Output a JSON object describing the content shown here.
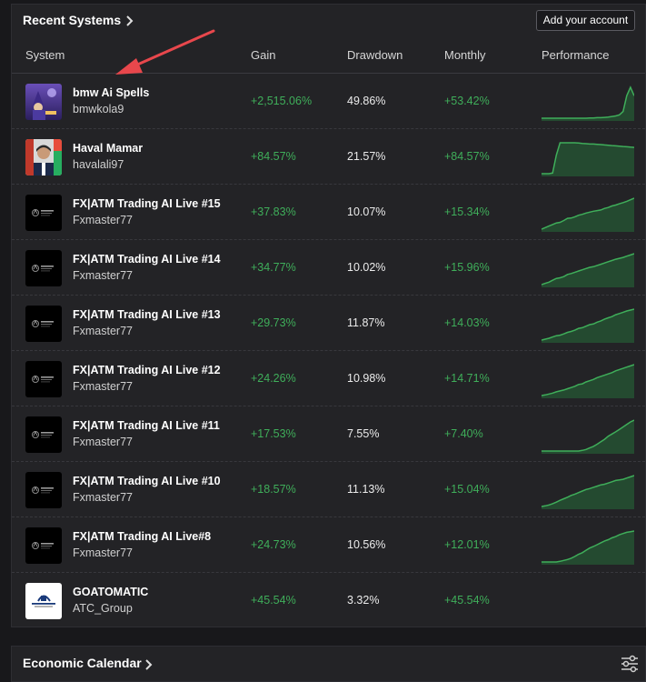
{
  "recent": {
    "title": "Recent Systems",
    "add_button": "Add your account",
    "columns": {
      "system": "System",
      "gain": "Gain",
      "drawdown": "Drawdown",
      "monthly": "Monthly",
      "performance": "Performance"
    },
    "rows": [
      {
        "name": "bmw Ai Spells",
        "user": "bmwkola9",
        "gain": "+2,515.06%",
        "drawdown": "49.86%",
        "monthly": "+53.42%",
        "avatar": "wizard-avatar",
        "perf": [
          0,
          0,
          0,
          0,
          0,
          0,
          0,
          0,
          0,
          0,
          0,
          0,
          0,
          0.5,
          0.5,
          1,
          1,
          1.5,
          2,
          3,
          4,
          6,
          12,
          40,
          55,
          40
        ]
      },
      {
        "name": "Haval Mamar",
        "user": "havalali97",
        "gain": "+84.57%",
        "drawdown": "21.57%",
        "monthly": "+84.57%",
        "avatar": "person-avatar",
        "perf": [
          0,
          0,
          0,
          2,
          60,
          100,
          100,
          100,
          100,
          100,
          99,
          98,
          97,
          96,
          96,
          95,
          94,
          93,
          92,
          91,
          90,
          89,
          88,
          87,
          86,
          85
        ]
      },
      {
        "name": "FX|ATM Trading AI Live #15",
        "user": "Fxmaster77",
        "gain": "+37.83%",
        "drawdown": "10.07%",
        "monthly": "+15.34%",
        "avatar": "fxatm-logo",
        "perf": [
          0,
          5,
          10,
          15,
          20,
          22,
          28,
          35,
          36,
          40,
          45,
          48,
          52,
          55,
          58,
          60,
          62,
          67,
          70,
          75,
          78,
          82,
          86,
          90,
          95,
          100
        ]
      },
      {
        "name": "FX|ATM Trading AI Live #14",
        "user": "Fxmaster77",
        "gain": "+34.77%",
        "drawdown": "10.02%",
        "monthly": "+15.96%",
        "avatar": "fxatm-logo",
        "perf": [
          0,
          4,
          8,
          14,
          20,
          22,
          26,
          33,
          36,
          40,
          44,
          48,
          52,
          56,
          58,
          62,
          66,
          70,
          74,
          78,
          82,
          85,
          88,
          92,
          96,
          100
        ]
      },
      {
        "name": "FX|ATM Trading AI Live #13",
        "user": "Fxmaster77",
        "gain": "+29.73%",
        "drawdown": "11.87%",
        "monthly": "+14.03%",
        "avatar": "fxatm-logo",
        "perf": [
          0,
          3,
          6,
          10,
          14,
          16,
          20,
          25,
          28,
          32,
          38,
          40,
          45,
          50,
          52,
          58,
          62,
          68,
          72,
          76,
          82,
          86,
          90,
          94,
          97,
          100
        ]
      },
      {
        "name": "FX|ATM Trading AI Live #12",
        "user": "Fxmaster77",
        "gain": "+24.26%",
        "drawdown": "10.98%",
        "monthly": "+14.71%",
        "avatar": "fxatm-logo",
        "perf": [
          0,
          2,
          5,
          8,
          12,
          15,
          18,
          22,
          26,
          30,
          36,
          38,
          44,
          48,
          52,
          58,
          62,
          66,
          70,
          74,
          80,
          84,
          88,
          92,
          96,
          100
        ]
      },
      {
        "name": "FX|ATM Trading AI Live #11",
        "user": "Fxmaster77",
        "gain": "+17.53%",
        "drawdown": "7.55%",
        "monthly": "+7.40%",
        "avatar": "fxatm-logo",
        "perf": [
          0,
          0,
          0,
          0,
          0,
          0,
          0,
          0,
          0,
          0,
          0,
          2,
          5,
          10,
          15,
          22,
          30,
          38,
          48,
          55,
          62,
          70,
          78,
          86,
          94,
          100
        ]
      },
      {
        "name": "FX|ATM Trading AI Live #10",
        "user": "Fxmaster77",
        "gain": "+18.57%",
        "drawdown": "11.13%",
        "monthly": "+15.04%",
        "avatar": "fxatm-logo",
        "perf": [
          0,
          2,
          5,
          9,
          14,
          20,
          25,
          30,
          36,
          40,
          45,
          50,
          55,
          58,
          62,
          66,
          70,
          72,
          76,
          80,
          84,
          86,
          88,
          92,
          96,
          100
        ]
      },
      {
        "name": "FX|ATM Trading AI Live#8",
        "user": "Fxmaster77",
        "gain": "+24.73%",
        "drawdown": "10.56%",
        "monthly": "+12.01%",
        "avatar": "fxatm-logo",
        "perf": [
          0,
          0,
          0,
          0,
          0,
          2,
          5,
          8,
          12,
          18,
          25,
          30,
          38,
          45,
          50,
          56,
          62,
          68,
          72,
          78,
          82,
          88,
          92,
          96,
          98,
          100
        ]
      },
      {
        "name": "GOATOMATIC",
        "user": "ATC_Group",
        "gain": "+45.54%",
        "drawdown": "3.32%",
        "monthly": "+45.54%",
        "avatar": "goatomatic-logo",
        "perf": []
      }
    ]
  },
  "calendar": {
    "title": "Economic Calendar"
  },
  "icons": {
    "title_chevron": "chevron-right-icon",
    "filter": "sliders-icon",
    "annotation": "red-arrow"
  },
  "colors": {
    "gain_positive": "#3fae5a",
    "spark_line": "#3fae5a",
    "spark_fill": "#244a30",
    "annotation_arrow": "#e8474c"
  }
}
